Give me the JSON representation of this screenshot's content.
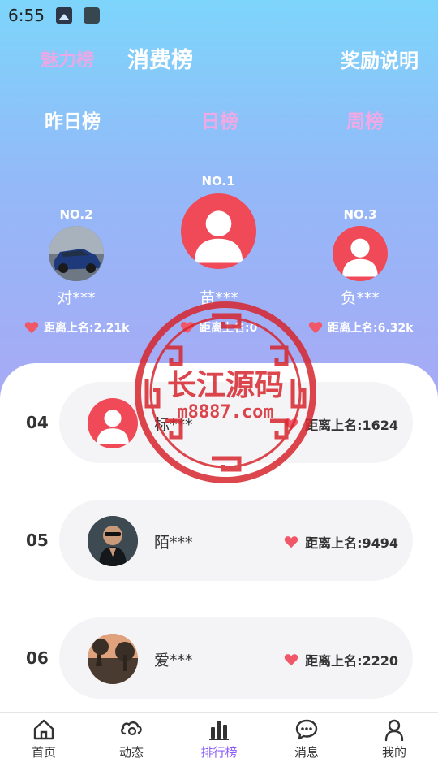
{
  "status_bar": {
    "time": "6:55"
  },
  "top_tabs": {
    "charm": "魅力榜",
    "spend": "消费榜",
    "rules": "奖励说明"
  },
  "period_tabs": {
    "yesterday": "昨日榜",
    "daily": "日榜",
    "weekly": "周榜"
  },
  "podium": {
    "first": {
      "rank": "NO.1",
      "name": "苗***",
      "gap": "距离上名:0"
    },
    "second": {
      "rank": "NO.2",
      "name": "对***",
      "gap": "距离上名:2.21k"
    },
    "third": {
      "rank": "NO.3",
      "name": "负***",
      "gap": "距离上名:6.32k"
    }
  },
  "list": [
    {
      "rank": "04",
      "name": "标***",
      "gap": "距离上名:1624"
    },
    {
      "rank": "05",
      "name": "陌***",
      "gap": "距离上名:9494"
    },
    {
      "rank": "06",
      "name": "爱***",
      "gap": "距离上名:2220"
    }
  ],
  "watermark": {
    "title": "长江源码",
    "url": "m8887.com"
  },
  "tabbar": [
    {
      "label": "首页",
      "icon": "home-icon"
    },
    {
      "label": "动态",
      "icon": "feed-icon"
    },
    {
      "label": "排行榜",
      "icon": "ranking-icon",
      "active": true
    },
    {
      "label": "消息",
      "icon": "message-icon"
    },
    {
      "label": "我的",
      "icon": "profile-icon"
    }
  ],
  "colors": {
    "accent": "#8b5cf6",
    "heart": "#f0586a",
    "default_avatar": "#f04a58",
    "hero_top": "#7dd5fb",
    "hero_bottom": "#a9a8f4"
  }
}
